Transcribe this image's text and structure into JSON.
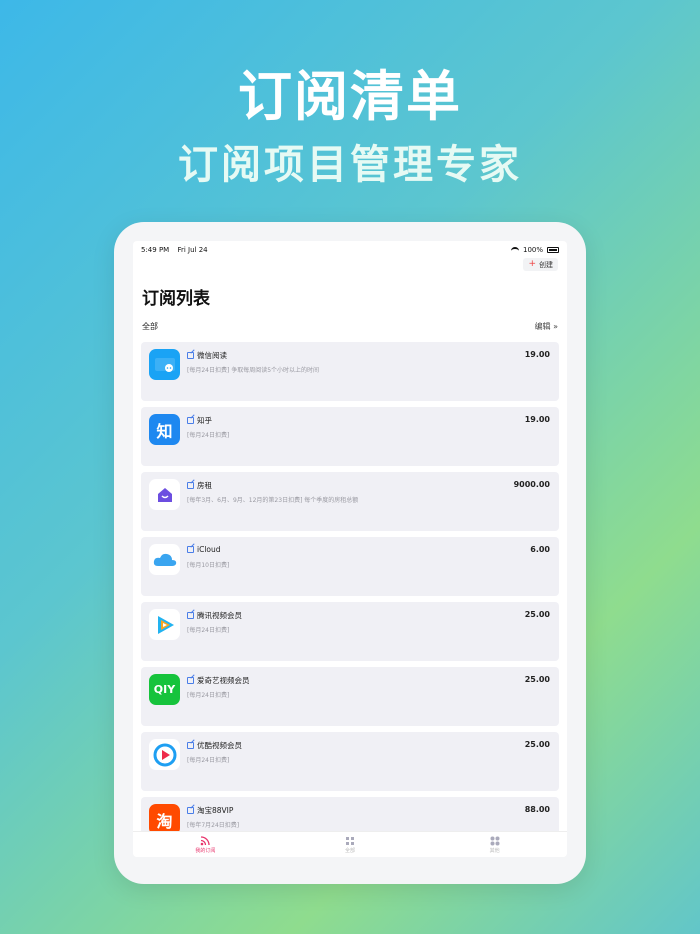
{
  "headline": {
    "title": "订阅清单",
    "subtitle": "订阅项目管理专家"
  },
  "status_bar": {
    "time": "5:49 PM",
    "date": "Fri Jul 24",
    "battery": "100%"
  },
  "toolbar": {
    "create_label": "创建"
  },
  "page": {
    "title": "订阅列表",
    "filter": "全部",
    "edit_label": "编辑 »"
  },
  "subscriptions": [
    {
      "name": "微信阅读",
      "desc": "[每月24日扣费] 争取每周阅读5个小时以上的时间",
      "price": "19.00",
      "icon": "wechat-read-icon",
      "color": "#1aa3f5"
    },
    {
      "name": "知乎",
      "desc": "[每月24日扣费]",
      "price": "19.00",
      "icon": "zhihu-icon",
      "color": "#1e88f0",
      "glyph": "知"
    },
    {
      "name": "房租",
      "desc": "[每年3月、6月、9月、12月的第23日扣费] 每个季度的房租总额",
      "price": "9000.00",
      "icon": "house-icon",
      "color": "#ffffff"
    },
    {
      "name": "iCloud",
      "desc": "[每月10日扣费]",
      "price": "6.00",
      "icon": "icloud-icon",
      "color": "#ffffff"
    },
    {
      "name": "腾讯视频会员",
      "desc": "[每月24日扣费]",
      "price": "25.00",
      "icon": "tencent-video-icon",
      "color": "#ffffff"
    },
    {
      "name": "爱奇艺视频会员",
      "desc": "[每月24日扣费]",
      "price": "25.00",
      "icon": "iqiyi-icon",
      "color": "#16c33c",
      "glyph": "QIY"
    },
    {
      "name": "优酷视频会员",
      "desc": "[每月24日扣费]",
      "price": "25.00",
      "icon": "youku-icon",
      "color": "#ffffff"
    },
    {
      "name": "淘宝88VIP",
      "desc": "[每年7月24日扣费]",
      "price": "88.00",
      "icon": "taobao-icon",
      "color": "#ff4a00",
      "glyph": "淘"
    }
  ],
  "tabbar": {
    "tabs": [
      {
        "label": "我的订阅"
      },
      {
        "label": "全部"
      },
      {
        "label": "其他"
      }
    ]
  }
}
